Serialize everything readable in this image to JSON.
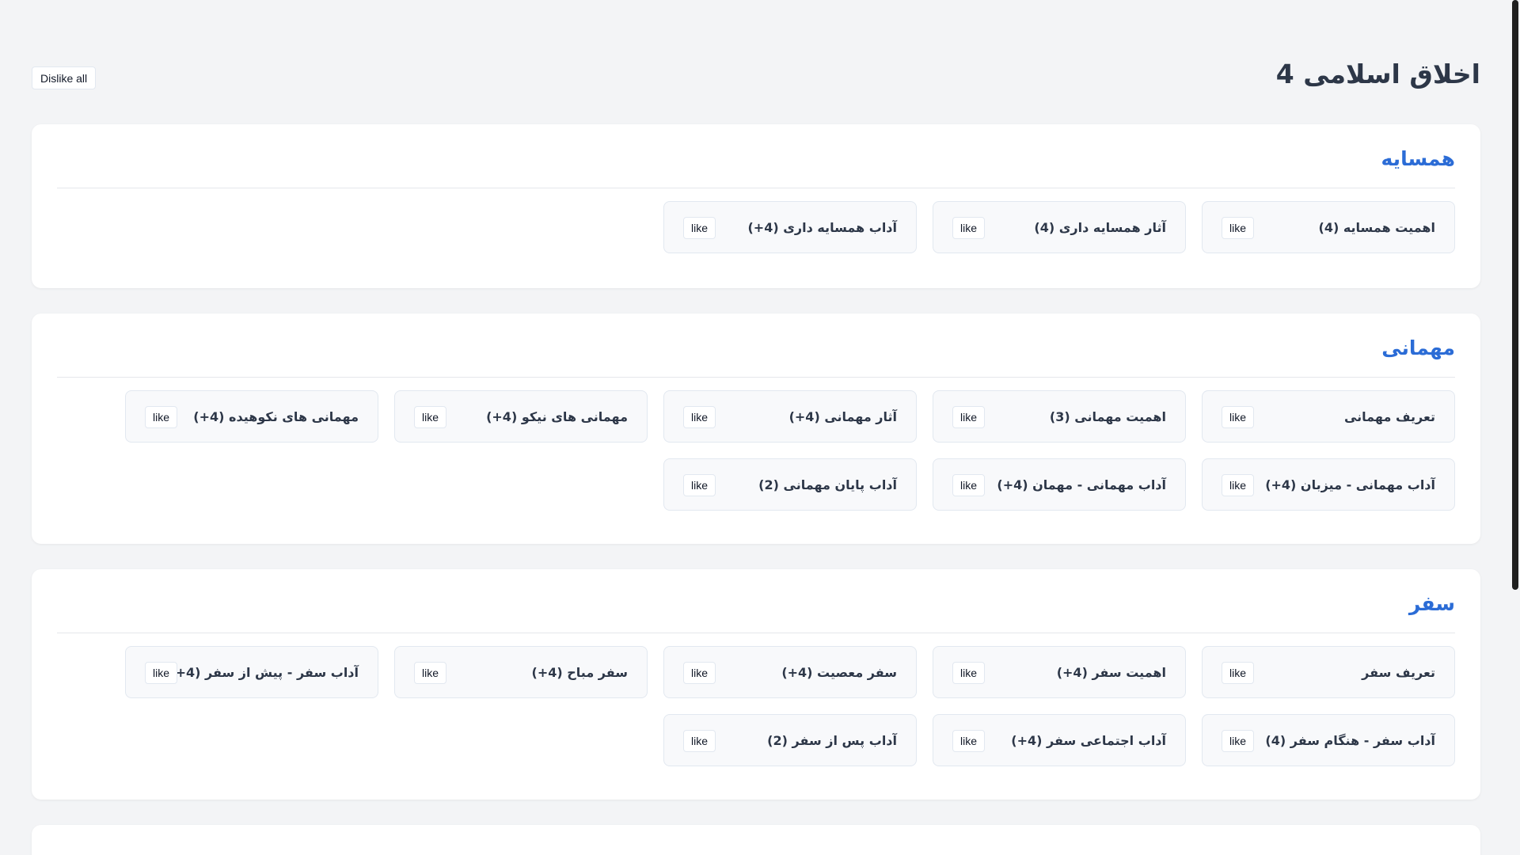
{
  "page": {
    "title": "اخلاق اسلامی 4",
    "dislike_all_label": "Dislike all"
  },
  "like_label": "like",
  "sections": [
    {
      "title": "همسایه",
      "cards": [
        "اهمیت همسایه (4)",
        "آثار همسایه داری (4)",
        "آداب همسایه داری (4+)"
      ]
    },
    {
      "title": "مهمانی",
      "cards": [
        "تعریف مهمانی",
        "اهمیت مهمانی (3)",
        "آثار مهمانی (4+)",
        "مهمانی های نیکو (4+)",
        "مهمانی های نکوهیده (4+)",
        "آداب مهمانی - میزبان (4+)",
        "آداب مهمانی - مهمان (4+)",
        "آداب پایان مهمانی (2)"
      ]
    },
    {
      "title": "سفر",
      "cards": [
        "تعریف سفر",
        "اهمیت سفر (4+)",
        "سفر معصیت (4+)",
        "سفر مباح (4+)",
        "آداب سفر - پیش از سفر (4+)",
        "آداب سفر - هنگام سفر (4)",
        "آداب اجتماعی سفر (4+)",
        "آداب پس از سفر (2)"
      ]
    },
    {
      "title": "",
      "cards": []
    }
  ],
  "colors": {
    "background": "#f3f4f6",
    "section_title": "#2b6cd6",
    "text": "#2d3748"
  }
}
